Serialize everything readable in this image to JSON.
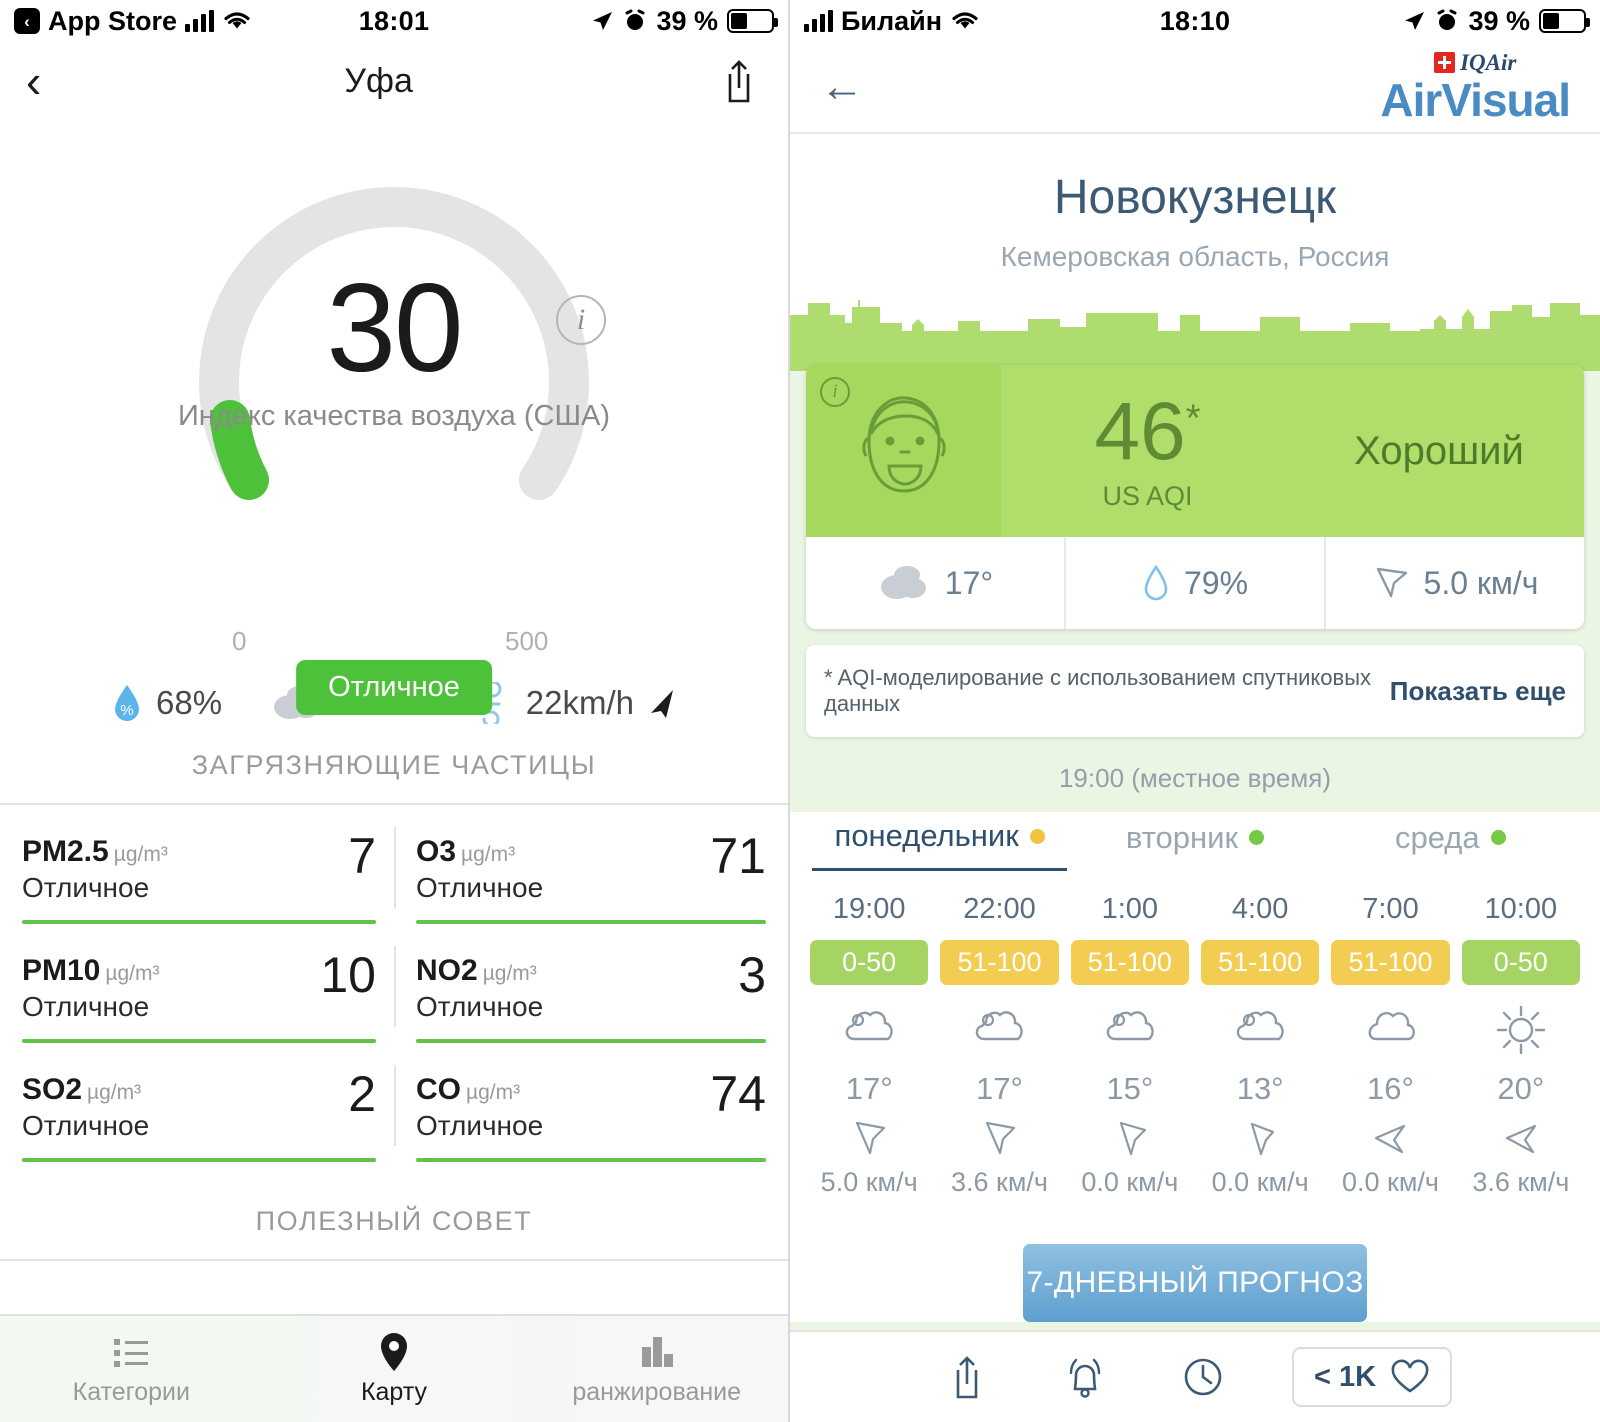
{
  "left": {
    "status": {
      "back_app": "App Store",
      "carrier_icon": "signal-bars-icon",
      "wifi_icon": "wifi-icon",
      "time": "18:01",
      "location_icon": "location-arrow-icon",
      "alarm_icon": "alarm-icon",
      "battery": "39 %"
    },
    "nav": {
      "back_icon": "chevron-left-icon",
      "title": "Уфа",
      "share_icon": "share-icon"
    },
    "gauge": {
      "value": "30",
      "label": "Индекс качества воздуха (США)",
      "scale_min": "0",
      "scale_max": "500",
      "badge": "Отличное",
      "info_icon": "info-icon",
      "arc_color": "#4ec13b",
      "track_color": "#e4e4e4"
    },
    "weather": [
      {
        "icon": "humidity-drop-icon",
        "value": "68%"
      },
      {
        "icon": "cloud-icon",
        "value": "18°C"
      },
      {
        "icon": "wind-icon",
        "value": "22km/h"
      },
      {
        "icon": "wind-direction-arrow-icon",
        "value": ""
      }
    ],
    "pollutants_header": "ЗАГРЯЗНЯЮЩИЕ ЧАСТИЦЫ",
    "pollutants": [
      {
        "name": "PM2.5",
        "unit": "µg/m³",
        "quality": "Отличное",
        "value": "7",
        "bar_color": "#62c24a"
      },
      {
        "name": "O3",
        "unit": "µg/m³",
        "quality": "Отличное",
        "value": "71",
        "bar_color": "#62c24a"
      },
      {
        "name": "PM10",
        "unit": "µg/m³",
        "quality": "Отличное",
        "value": "10",
        "bar_color": "#62c24a"
      },
      {
        "name": "NO2",
        "unit": "µg/m³",
        "quality": "Отличное",
        "value": "3",
        "bar_color": "#62c24a"
      },
      {
        "name": "SO2",
        "unit": "µg/m³",
        "quality": "Отличное",
        "value": "2",
        "bar_color": "#62c24a"
      },
      {
        "name": "CO",
        "unit": "µg/m³",
        "quality": "Отличное",
        "value": "74",
        "bar_color": "#62c24a"
      }
    ],
    "tip_header": "ПОЛЕЗНЫЙ СОВЕТ",
    "tabs": [
      {
        "icon": "list-icon",
        "label": "Категории",
        "active": false
      },
      {
        "icon": "map-pin-icon",
        "label": "Карту",
        "active": true
      },
      {
        "icon": "bar-chart-icon",
        "label": "ранжирование",
        "active": false
      }
    ]
  },
  "right": {
    "status": {
      "carrier": "Билайн",
      "time": "18:10",
      "battery": "39 %"
    },
    "nav": {
      "back_icon": "arrow-left-icon",
      "logo_top": "IQAir",
      "logo_main": "AirVisual"
    },
    "city": "Новокузнецк",
    "region": "Кемеровская область, Россия",
    "aqi_card": {
      "info_icon": "info-icon",
      "face_icon": "happy-face-icon",
      "value": "46",
      "asterisk": "*",
      "scale": "US AQI",
      "word": "Хороший",
      "bg_color": "#b1de6b",
      "weather": [
        {
          "icon": "cloud-icon",
          "value": "17°"
        },
        {
          "icon": "humidity-drop-icon",
          "value": "79%"
        },
        {
          "icon": "wind-direction-arrow-icon",
          "value": "5.0 км/ч"
        }
      ]
    },
    "disclaimer": {
      "text": "* AQI-моделирование с использованием спутниковых данных",
      "link": "Показать еще"
    },
    "local_time": "19:00 (местное время)",
    "day_tabs": [
      {
        "label": "понедельник",
        "dot_color": "#f1c340",
        "active": true
      },
      {
        "label": "вторник",
        "dot_color": "#74c947",
        "active": false
      },
      {
        "label": "среда",
        "dot_color": "#74c947",
        "active": false
      }
    ],
    "hours": [
      {
        "time": "19:00",
        "badge": "0-50",
        "badge_color": "#a5d462",
        "weather_icon": "partly-cloudy-icon",
        "temp": "17°",
        "wind_icon": "wind-direction-arrow-icon",
        "wind": "5.0 км/ч"
      },
      {
        "time": "22:00",
        "badge": "51-100",
        "badge_color": "#f3cd52",
        "weather_icon": "partly-cloudy-icon",
        "temp": "17°",
        "wind_icon": "wind-direction-arrow-icon",
        "wind": "3.6 км/ч"
      },
      {
        "time": "1:00",
        "badge": "51-100",
        "badge_color": "#f3cd52",
        "weather_icon": "partly-cloudy-icon",
        "temp": "15°",
        "wind_icon": "wind-direction-arrow-icon",
        "wind": "0.0 км/ч"
      },
      {
        "time": "4:00",
        "badge": "51-100",
        "badge_color": "#f3cd52",
        "weather_icon": "partly-cloudy-icon",
        "temp": "13°",
        "wind_icon": "wind-direction-arrow-icon",
        "wind": "0.0 км/ч"
      },
      {
        "time": "7:00",
        "badge": "51-100",
        "badge_color": "#f3cd52",
        "weather_icon": "cloud-icon",
        "temp": "16°",
        "wind_icon": "wind-direction-arrow-icon",
        "wind": "0.0 км/ч"
      },
      {
        "time": "10:00",
        "badge": "0-50",
        "badge_color": "#a5d462",
        "weather_icon": "sun-icon",
        "temp": "20°",
        "wind_icon": "wind-direction-arrow-icon",
        "wind": "3.6 км/ч"
      }
    ],
    "forecast_button": "7-ДНЕВНЫЙ ПРОГНОЗ",
    "bottom_bar": {
      "icons": [
        "share-icon",
        "bell-icon",
        "clock-icon"
      ],
      "fav_count": "< 1K",
      "heart_icon": "heart-icon"
    }
  }
}
